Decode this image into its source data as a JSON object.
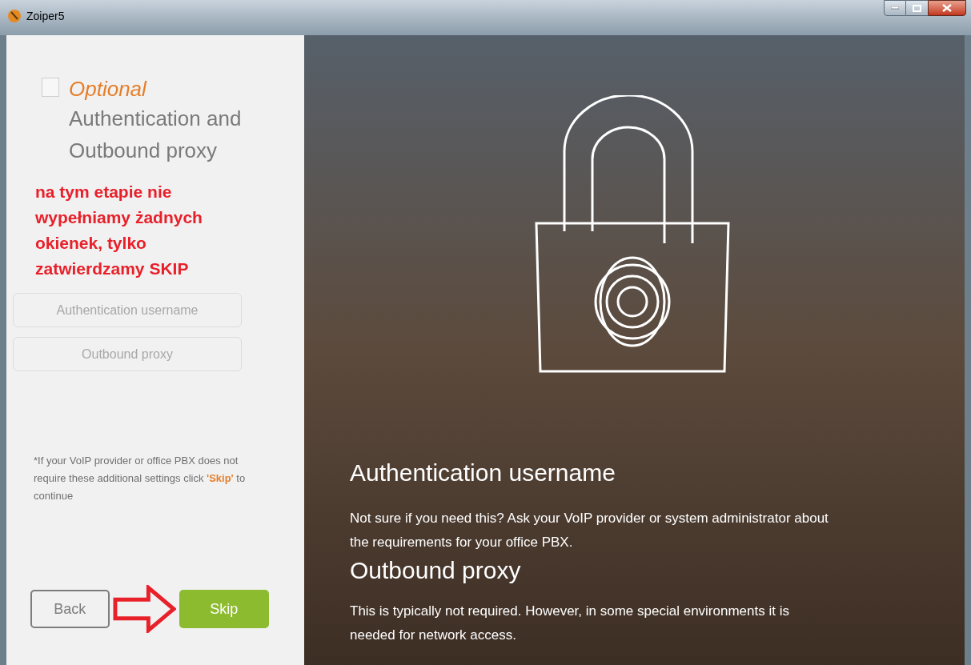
{
  "window": {
    "title": "Zoiper5"
  },
  "sidebar": {
    "optional_checkbox": {
      "checked": false
    },
    "optional_label": "Optional",
    "heading": "Authentication and Outbound proxy",
    "annotation": "na tym etapie nie wypełniamy żadnych okienek, tylko zatwierdzamy SKIP",
    "fields": [
      {
        "placeholder": "Authentication username"
      },
      {
        "placeholder": "Outbound proxy"
      }
    ],
    "note": "*If your VoIP provider or office PBX does not require these additional settings click **'Skip'** to continue",
    "buttons": [
      {
        "label": "Back",
        "kind": "secondary"
      },
      {
        "label": "Skip",
        "kind": "primary"
      }
    ]
  },
  "info": [
    {
      "title": "Authentication username",
      "text": "Not sure if you need this? Ask your VoIP provider or system administrator about the requirements for your office PBX."
    },
    {
      "title": "Outbound proxy",
      "text": "This is typically not required. However, in some special environments it is needed for network access."
    }
  ]
}
